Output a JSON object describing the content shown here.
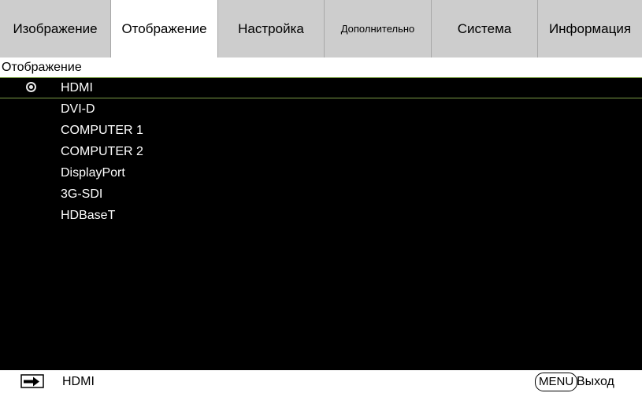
{
  "tabs": [
    {
      "label": "Изображение",
      "active": false
    },
    {
      "label": "Отображение",
      "active": true
    },
    {
      "label": "Настройка",
      "active": false
    },
    {
      "label": "Дополнительно",
      "active": false
    },
    {
      "label": "Система",
      "active": false
    },
    {
      "label": "Информация",
      "active": false
    }
  ],
  "section": {
    "title": "Отображение"
  },
  "inputs": [
    {
      "label": "HDMI",
      "selected": true
    },
    {
      "label": "DVI-D",
      "selected": false
    },
    {
      "label": "COMPUTER 1",
      "selected": false
    },
    {
      "label": "COMPUTER 2",
      "selected": false
    },
    {
      "label": "DisplayPort",
      "selected": false
    },
    {
      "label": "3G-SDI",
      "selected": false
    },
    {
      "label": "HDBaseT",
      "selected": false
    }
  ],
  "footer": {
    "source_icon": "input-arrow-icon",
    "source": "HDMI",
    "menu_key": "MENU",
    "exit": "Выход"
  },
  "colors": {
    "highlight_border": "#7a9c45",
    "menubar": "#cdcdcd",
    "background": "#000000"
  }
}
